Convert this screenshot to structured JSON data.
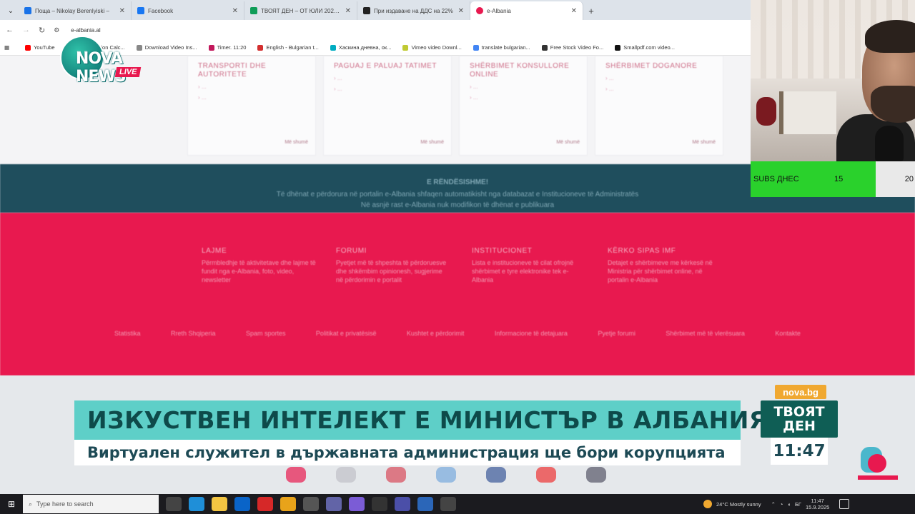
{
  "browser": {
    "tabs": [
      {
        "title": "Поща – Nikolay Berenlyiski – ",
        "color": "#1a73e8"
      },
      {
        "title": "Facebook",
        "color": "#1877f2"
      },
      {
        "title": "ТВОЯТ ДЕН – ОТ ЮЛИ 2025 – ",
        "color": "#0f9d58"
      },
      {
        "title": "При издаване на ДДС на 22% ",
        "color": "#222222"
      },
      {
        "title": "e-Albania",
        "color": "#e8194f"
      }
    ],
    "active_tab": 4,
    "new_tab": "+",
    "url": "e-albania.al",
    "bookmarks": [
      {
        "label": "YouTube",
        "color": "#ff0000"
      },
      {
        "label": "Time Duration Calc...",
        "color": "#2962ff"
      },
      {
        "label": "Download Video Ins...",
        "color": "#888888"
      },
      {
        "label": "Timer. 11:20",
        "color": "#c2185b"
      },
      {
        "label": "English - Bulgarian t...",
        "color": "#d32f2f"
      },
      {
        "label": "Хаскина дневна, ок...",
        "color": "#00acc1"
      },
      {
        "label": "Vimeo video Downl...",
        "color": "#c0ca33"
      },
      {
        "label": "translate bulgarian...",
        "color": "#4285f4"
      },
      {
        "label": "Free Stock Video Fo...",
        "color": "#333333"
      },
      {
        "label": "Smallpdf.com video...",
        "color": "#111111"
      }
    ]
  },
  "logo": {
    "word": "NOVA NEWS",
    "live": "LIVE",
    "mark": "N"
  },
  "page": {
    "cards": [
      {
        "title": "TRANSPORTI DHE AUTORITETE",
        "lines": [
          "› ...",
          "› ..."
        ],
        "foot": "Më shumë"
      },
      {
        "title": "PAGUAJ E PALUAJ TATIMET",
        "lines": [
          "› ...",
          "› ..."
        ],
        "foot": "Më shumë"
      },
      {
        "title": "SHËRBIMET KONSULLORE ONLINE",
        "lines": [
          "› ...",
          "› ..."
        ],
        "foot": "Më shumë"
      },
      {
        "title": "SHËRBIMET DOGANORE",
        "lines": [
          "› ...",
          "› ..."
        ],
        "foot": "Më shumë"
      }
    ],
    "notice": {
      "heading": "E RËNDËSISHME!",
      "text1": "Të dhënat e përdorura në portalin e-Albania shfaqen automatikisht nga databazat e Institucioneve të Administratës",
      "text2": "Në asnjë rast e-Albania nuk modifikon të dhënat e publikuara"
    },
    "footer_columns": [
      {
        "title": "LAJME",
        "text": "Përmbledhje të aktivitetave dhe lajme të fundit nga e-Albania, foto, video, newsletter"
      },
      {
        "title": "FORUMI",
        "text": "Pyetjet më të shpeshta të përdoruesve dhe shkëmbim opinionesh, sugjerime në përdorimin e portalit"
      },
      {
        "title": "INSTITUCIONET",
        "text": "Lista e institucioneve të cilat ofrojnë shërbimet e tyre elektronike tek e-Albania"
      },
      {
        "title": "KËRKO SIPAS IMF",
        "text": "Detajet e shërbimeve me kërkesë në Ministria për shërbimet online, në portalin e-Albania"
      }
    ],
    "footer_links": [
      "Statistika",
      "Rreth Shqiperia",
      "Spam sportes",
      "Politikat e privatësisë",
      "Kushtet e përdorimit",
      "Informacione të detajuara",
      "Pyetje forumi",
      "Shërbimet më të vlerësuara",
      "Kontakte"
    ]
  },
  "webcam": {
    "subs_label": "SUBS ДНЕС",
    "subs_value": "15",
    "subs_value_2": "20"
  },
  "broadcast": {
    "site": "nova.bg",
    "headline": "ИЗКУСТВЕН ИНТЕЛЕКТ Е МИНИСТЪР В АЛБАНИЯ",
    "subline": "Виртуален служител в държавната администрация ще бори корупцията",
    "show_name_line1": "ТВОЯТ",
    "show_name_line2": "ДЕН",
    "time": "11:47"
  },
  "taskbar": {
    "search_placeholder": "Type here to search",
    "weather": "24°C  Mostly sunny",
    "tray_lang": "БГ",
    "tray_time": "11:47",
    "tray_date": "15.9.2025"
  },
  "colors": {
    "accent_red": "#e8194f",
    "news_teal": "#5ecfc8",
    "show_green": "#0f5e55",
    "subs_green": "#2ad12c",
    "nova_orange": "#f0a830"
  }
}
